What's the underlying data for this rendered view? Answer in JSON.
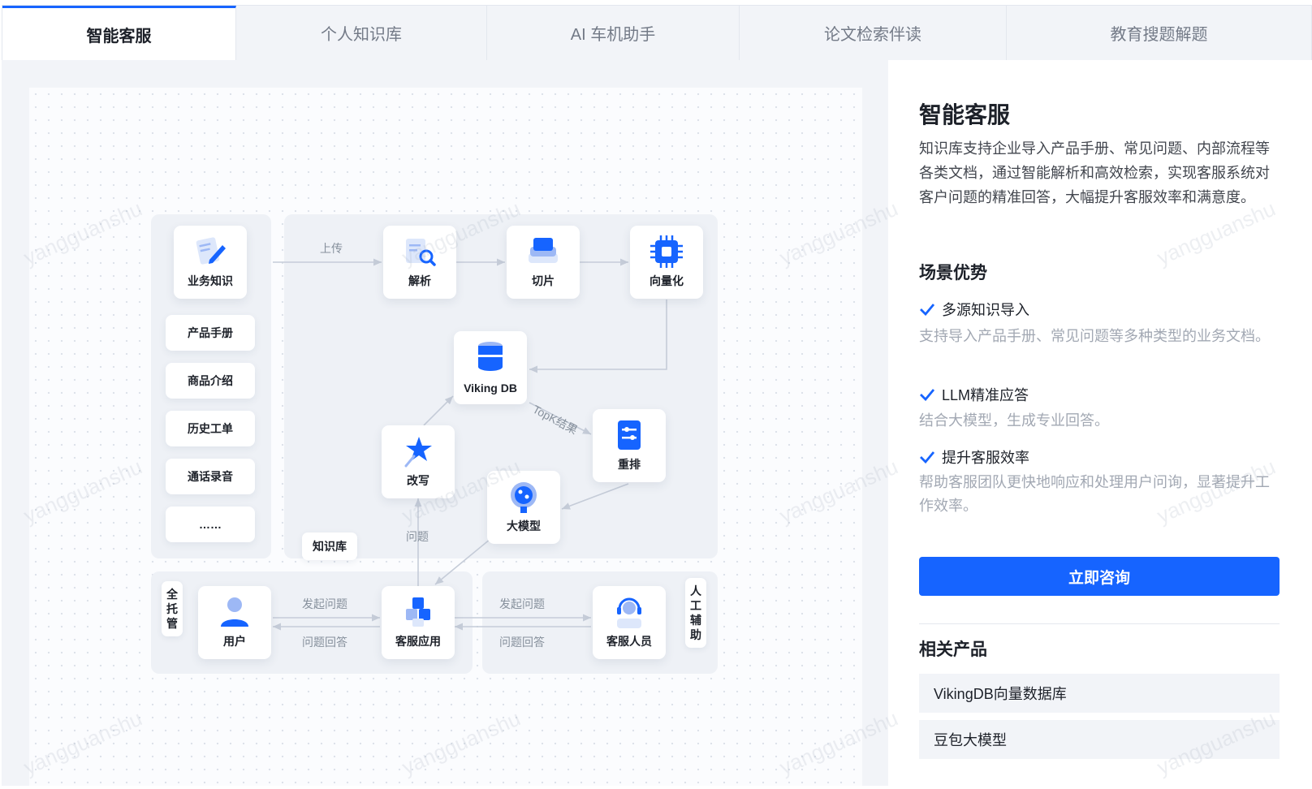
{
  "tabs": [
    "智能客服",
    "个人知识库",
    "AI 车机助手",
    "论文检索伴读",
    "教育搜题解题"
  ],
  "watermark": "yangguanshu",
  "diagram": {
    "nodes": {
      "business_knowledge": "业务知识",
      "parse": "解析",
      "slice": "切片",
      "vectorize": "向量化",
      "viking_db": "Viking DB",
      "rewrite": "改写",
      "rerank": "重排",
      "llm": "大模型",
      "user": "用户",
      "cs_app": "客服应用",
      "cs_agent": "客服人员"
    },
    "sources": [
      "产品手册",
      "商品介绍",
      "历史工单",
      "通话录音",
      "……"
    ],
    "edge_labels": {
      "upload": "上传",
      "topk": "TopK结果",
      "question": "问题",
      "ask_left": "发起问题",
      "answer_left": "问题回答",
      "ask_right": "发起问题",
      "answer_right": "问题回答"
    },
    "tags": {
      "knowledge_base": "知识库",
      "full_managed": "全托管",
      "human_assist": "人工辅助"
    }
  },
  "panel": {
    "title": "智能客服",
    "description": "知识库支持企业导入产品手册、常见问题、内部流程等各类文档，通过智能解析和高效检索，实现客服系统对客户问题的精准回答，大幅提升客服效率和满意度。",
    "advantages_title": "场景优势",
    "advantages": [
      {
        "title": "多源知识导入",
        "desc": "支持导入产品手册、常见问题等多种类型的业务文档。"
      },
      {
        "title": "LLM精准应答",
        "desc": "结合大模型，生成专业回答。"
      },
      {
        "title": "提升客服效率",
        "desc": "帮助客服团队更快地响应和处理用户问询，显著提升工作效率。"
      }
    ],
    "cta": "立即咨询",
    "related_title": "相关产品",
    "related": [
      "VikingDB向量数据库",
      "豆包大模型"
    ]
  },
  "colors": {
    "accent": "#1664ff",
    "text": "#1d2129",
    "muted": "#a2a8b3"
  }
}
